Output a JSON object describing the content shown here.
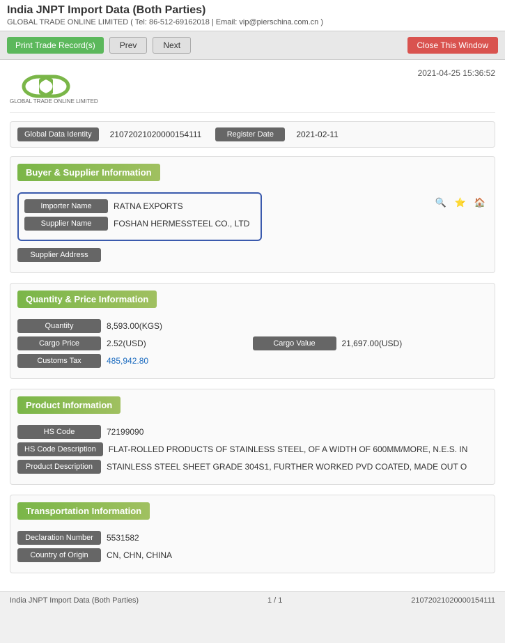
{
  "page": {
    "title": "India JNPT Import Data (Both Parties)",
    "subtitle": "GLOBAL TRADE ONLINE LIMITED ( Tel: 86-512-69162018 | Email: vip@pierschina.com.cn )",
    "datetime": "2021-04-25 15:36:52"
  },
  "toolbar": {
    "print_label": "Print Trade Record(s)",
    "prev_label": "Prev",
    "next_label": "Next",
    "close_label": "Close This Window"
  },
  "identity": {
    "global_data_label": "Global Data Identity",
    "global_data_value": "21072021020000154111",
    "register_date_label": "Register Date",
    "register_date_value": "2021-02-11"
  },
  "buyer_supplier": {
    "section_title": "Buyer & Supplier Information",
    "importer_label": "Importer Name",
    "importer_value": "RATNA EXPORTS",
    "supplier_label": "Supplier Name",
    "supplier_value": "FOSHAN HERMESSTEEL CO., LTD",
    "supplier_address_label": "Supplier Address",
    "supplier_address_value": ""
  },
  "quantity_price": {
    "section_title": "Quantity & Price Information",
    "quantity_label": "Quantity",
    "quantity_value": "8,593.00(KGS)",
    "cargo_price_label": "Cargo Price",
    "cargo_price_value": "2.52(USD)",
    "cargo_value_label": "Cargo Value",
    "cargo_value_value": "21,697.00(USD)",
    "customs_tax_label": "Customs Tax",
    "customs_tax_value": "485,942.80"
  },
  "product": {
    "section_title": "Product Information",
    "hs_code_label": "HS Code",
    "hs_code_value": "72199090",
    "hs_code_desc_label": "HS Code Description",
    "hs_code_desc_value": "FLAT-ROLLED PRODUCTS OF STAINLESS STEEL, OF A WIDTH OF 600MM/MORE, N.E.S. IN",
    "product_desc_label": "Product Description",
    "product_desc_value": "STAINLESS STEEL SHEET GRADE 304S1, FURTHER WORKED PVD COATED, MADE OUT O"
  },
  "transportation": {
    "section_title": "Transportation Information",
    "declaration_label": "Declaration Number",
    "declaration_value": "5531582",
    "country_origin_label": "Country of Origin",
    "country_origin_value": "CN, CHN, CHINA"
  },
  "footer": {
    "left": "India JNPT Import Data (Both Parties)",
    "center": "1 / 1",
    "right": "21072021020000154111"
  },
  "icons": {
    "search": "🔍",
    "star": "⭐",
    "home": "🏠"
  }
}
